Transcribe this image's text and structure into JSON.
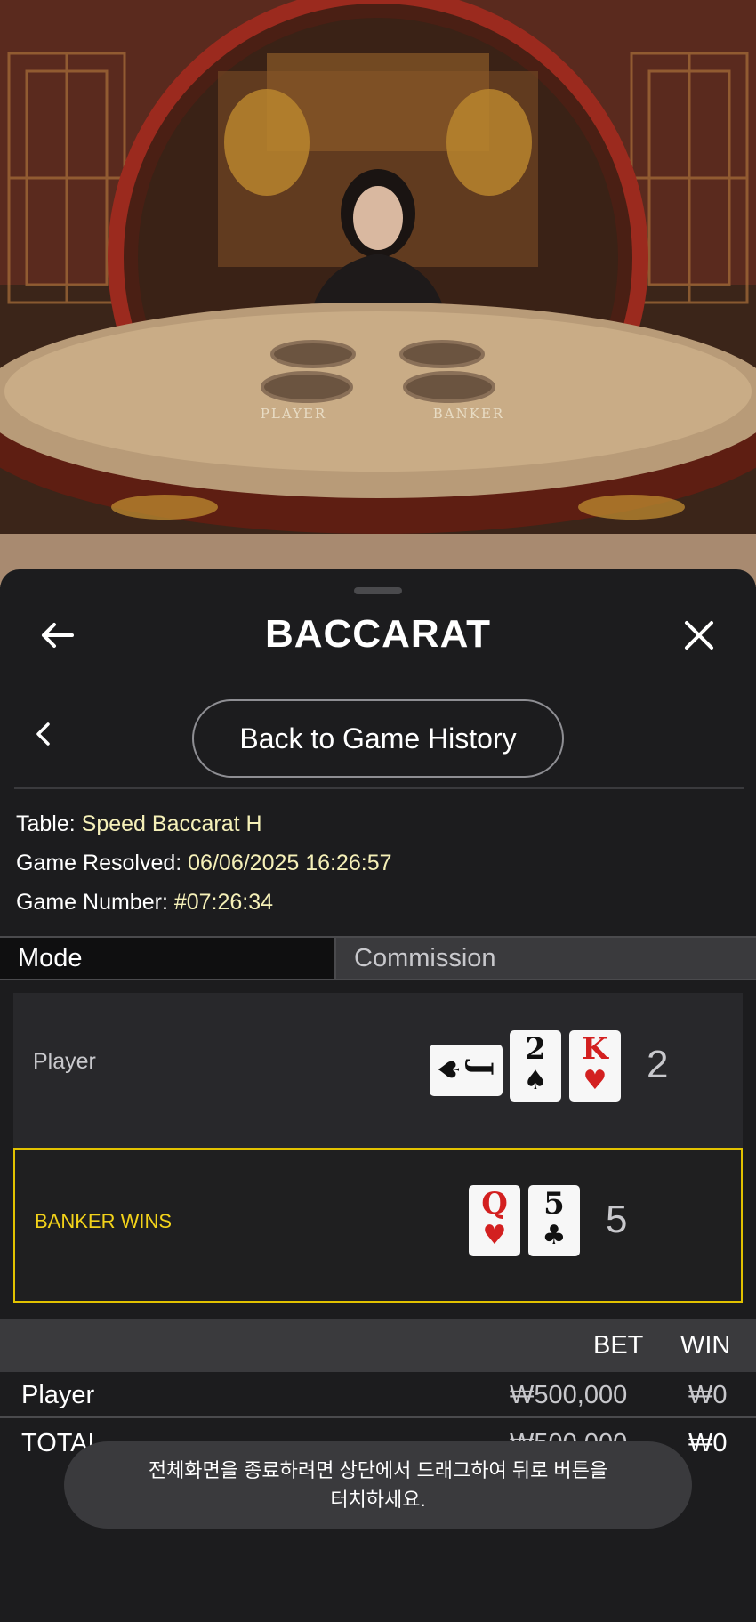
{
  "header": {
    "title": "BACCARAT"
  },
  "history_button": {
    "label": "Back to Game History"
  },
  "info": {
    "table_label": "Table:",
    "table_value": "Speed Baccarat H",
    "resolved_label": "Game Resolved:",
    "resolved_value": "06/06/2025 16:26:57",
    "number_label": "Game Number:",
    "number_value": "#07:26:34"
  },
  "tabs": [
    {
      "label": "Mode"
    },
    {
      "label": "Commission"
    }
  ],
  "results": {
    "player": {
      "label": "Player",
      "score": "2",
      "cards": [
        {
          "rank": "J",
          "suit": "♠",
          "color": "black",
          "orientation": "sideways"
        },
        {
          "rank": "2",
          "suit": "♠",
          "color": "black"
        },
        {
          "rank": "K",
          "suit": "♥",
          "color": "red"
        }
      ]
    },
    "banker": {
      "label": "BANKER WINS",
      "score": "5",
      "cards": [
        {
          "rank": "Q",
          "suit": "♥",
          "color": "red"
        },
        {
          "rank": "5",
          "suit": "♣",
          "color": "black"
        }
      ]
    }
  },
  "bets": {
    "headers": {
      "bet": "BET",
      "win": "WIN"
    },
    "rows": [
      {
        "name": "Player",
        "bet": "₩500,000",
        "win": "₩0"
      }
    ],
    "total": {
      "name": "TOTAL",
      "bet": "₩500,000",
      "win": "₩0"
    }
  },
  "video": {
    "table_player_label": "PLAYER",
    "table_banker_label": "BANKER"
  },
  "toast": {
    "line1": "전체화면을 종료하려면 상단에서 드래그하여 뒤로 버튼을",
    "line2": "터치하세요."
  },
  "colors": {
    "accent_win": "#e2c200",
    "info_value": "#f5f0b8",
    "sheet_bg": "#1c1c1e"
  }
}
